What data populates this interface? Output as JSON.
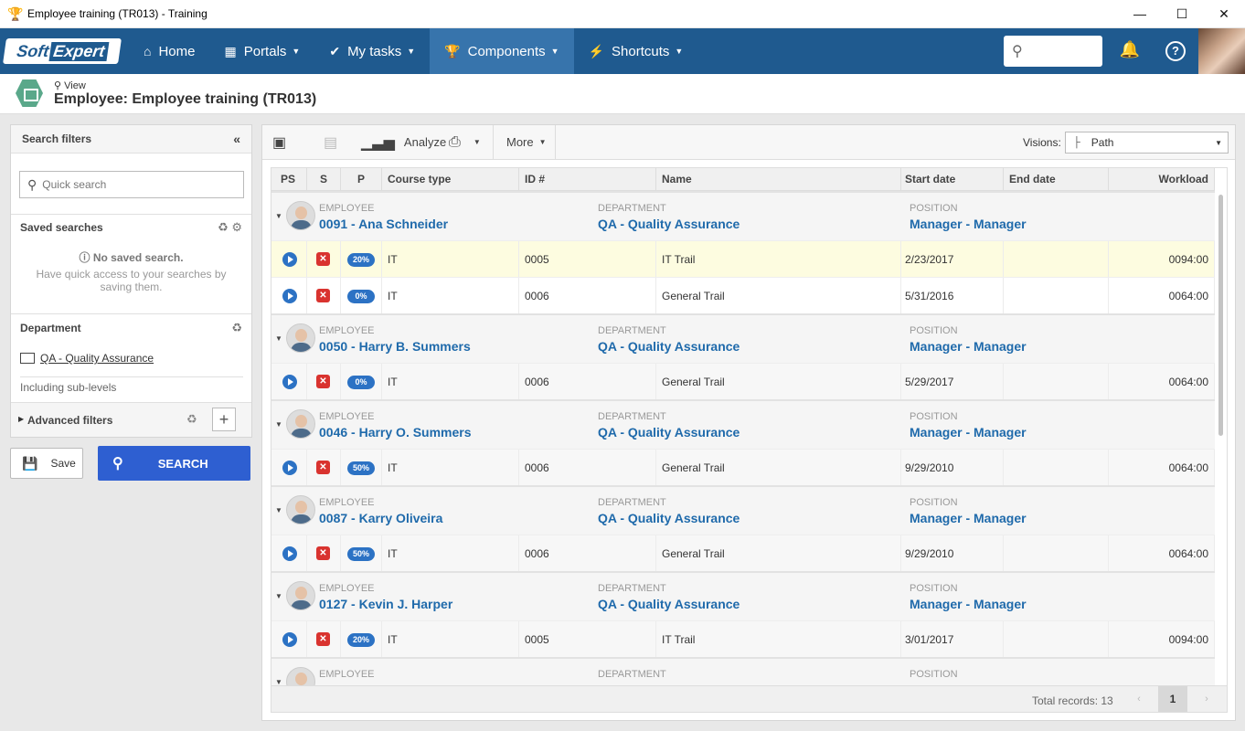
{
  "window": {
    "title": "Employee training (TR013) - Training",
    "minimize_icon": "—",
    "maximize_icon": "☐",
    "close_icon": "✕"
  },
  "nav": {
    "logo_soft": "Soft",
    "logo_expert": "Expert",
    "items": [
      {
        "label": "Home",
        "icon": "home-icon"
      },
      {
        "label": "Portals",
        "icon": "grid-icon"
      },
      {
        "label": "My tasks",
        "icon": "check-icon"
      },
      {
        "label": "Components",
        "icon": "trophy-icon"
      },
      {
        "label": "Shortcuts",
        "icon": "bolt-icon"
      }
    ],
    "active": "Components",
    "colors": {
      "bar": "#1f5a8f",
      "active": "#3774ac"
    }
  },
  "page": {
    "view_label": "View",
    "title": "Employee: Employee training (TR013)"
  },
  "filters": {
    "header": "Search filters",
    "quick_search_placeholder": "Quick search",
    "saved_searches_title": "Saved searches",
    "no_saved": "No saved search.",
    "no_saved_desc": "Have quick access to your searches by saving them.",
    "department_title": "Department",
    "department_value": "QA - Quality Assurance",
    "including": "Including sub-levels",
    "advanced": "Advanced filters",
    "save_label": "Save",
    "search_label": "SEARCH"
  },
  "toolbar": {
    "analyze_label": "Analyze",
    "more_label": "More",
    "visions_label": "Visions:",
    "visions_value": "Path"
  },
  "grid": {
    "columns": [
      "PS",
      "S",
      "P",
      "Course type",
      "ID #",
      "Name",
      "Start date",
      "End date",
      "Workload"
    ],
    "group_labels": {
      "employee": "EMPLOYEE",
      "department": "DEPARTMENT",
      "position": "POSITION"
    },
    "groups": [
      {
        "employee": "0091 - Ana Schneider",
        "department": "QA - Quality Assurance",
        "position": "Manager - Manager",
        "rows": [
          {
            "p": "20%",
            "course_type": "IT",
            "id": "0005",
            "name": "IT Trail",
            "start": "2/23/2017",
            "end": "",
            "workload": "0094:00"
          },
          {
            "p": "0%",
            "course_type": "IT",
            "id": "0006",
            "name": "General Trail",
            "start": "5/31/2016",
            "end": "",
            "workload": "0064:00"
          }
        ]
      },
      {
        "employee": "0050 - Harry B. Summers",
        "department": "QA - Quality Assurance",
        "position": "Manager - Manager",
        "rows": [
          {
            "p": "0%",
            "course_type": "IT",
            "id": "0006",
            "name": "General Trail",
            "start": "5/29/2017",
            "end": "",
            "workload": "0064:00"
          }
        ]
      },
      {
        "employee": "0046 - Harry O. Summers",
        "department": "QA - Quality Assurance",
        "position": "Manager - Manager",
        "rows": [
          {
            "p": "50%",
            "course_type": "IT",
            "id": "0006",
            "name": "General Trail",
            "start": "9/29/2010",
            "end": "",
            "workload": "0064:00"
          }
        ]
      },
      {
        "employee": "0087 - Karry Oliveira",
        "department": "QA - Quality Assurance",
        "position": "Manager - Manager",
        "rows": [
          {
            "p": "50%",
            "course_type": "IT",
            "id": "0006",
            "name": "General Trail",
            "start": "9/29/2010",
            "end": "",
            "workload": "0064:00"
          }
        ]
      },
      {
        "employee": "0127 - Kevin J. Harper",
        "department": "QA - Quality Assurance",
        "position": "Manager - Manager",
        "rows": [
          {
            "p": "20%",
            "course_type": "IT",
            "id": "0005",
            "name": "IT Trail",
            "start": "3/01/2017",
            "end": "",
            "workload": "0094:00"
          }
        ]
      },
      {
        "employee": "",
        "department": "",
        "position": "",
        "rows": []
      }
    ],
    "footer": {
      "total": "Total records: 13",
      "current_page": "1",
      "prev_icon": "‹",
      "next_icon": "›"
    }
  }
}
